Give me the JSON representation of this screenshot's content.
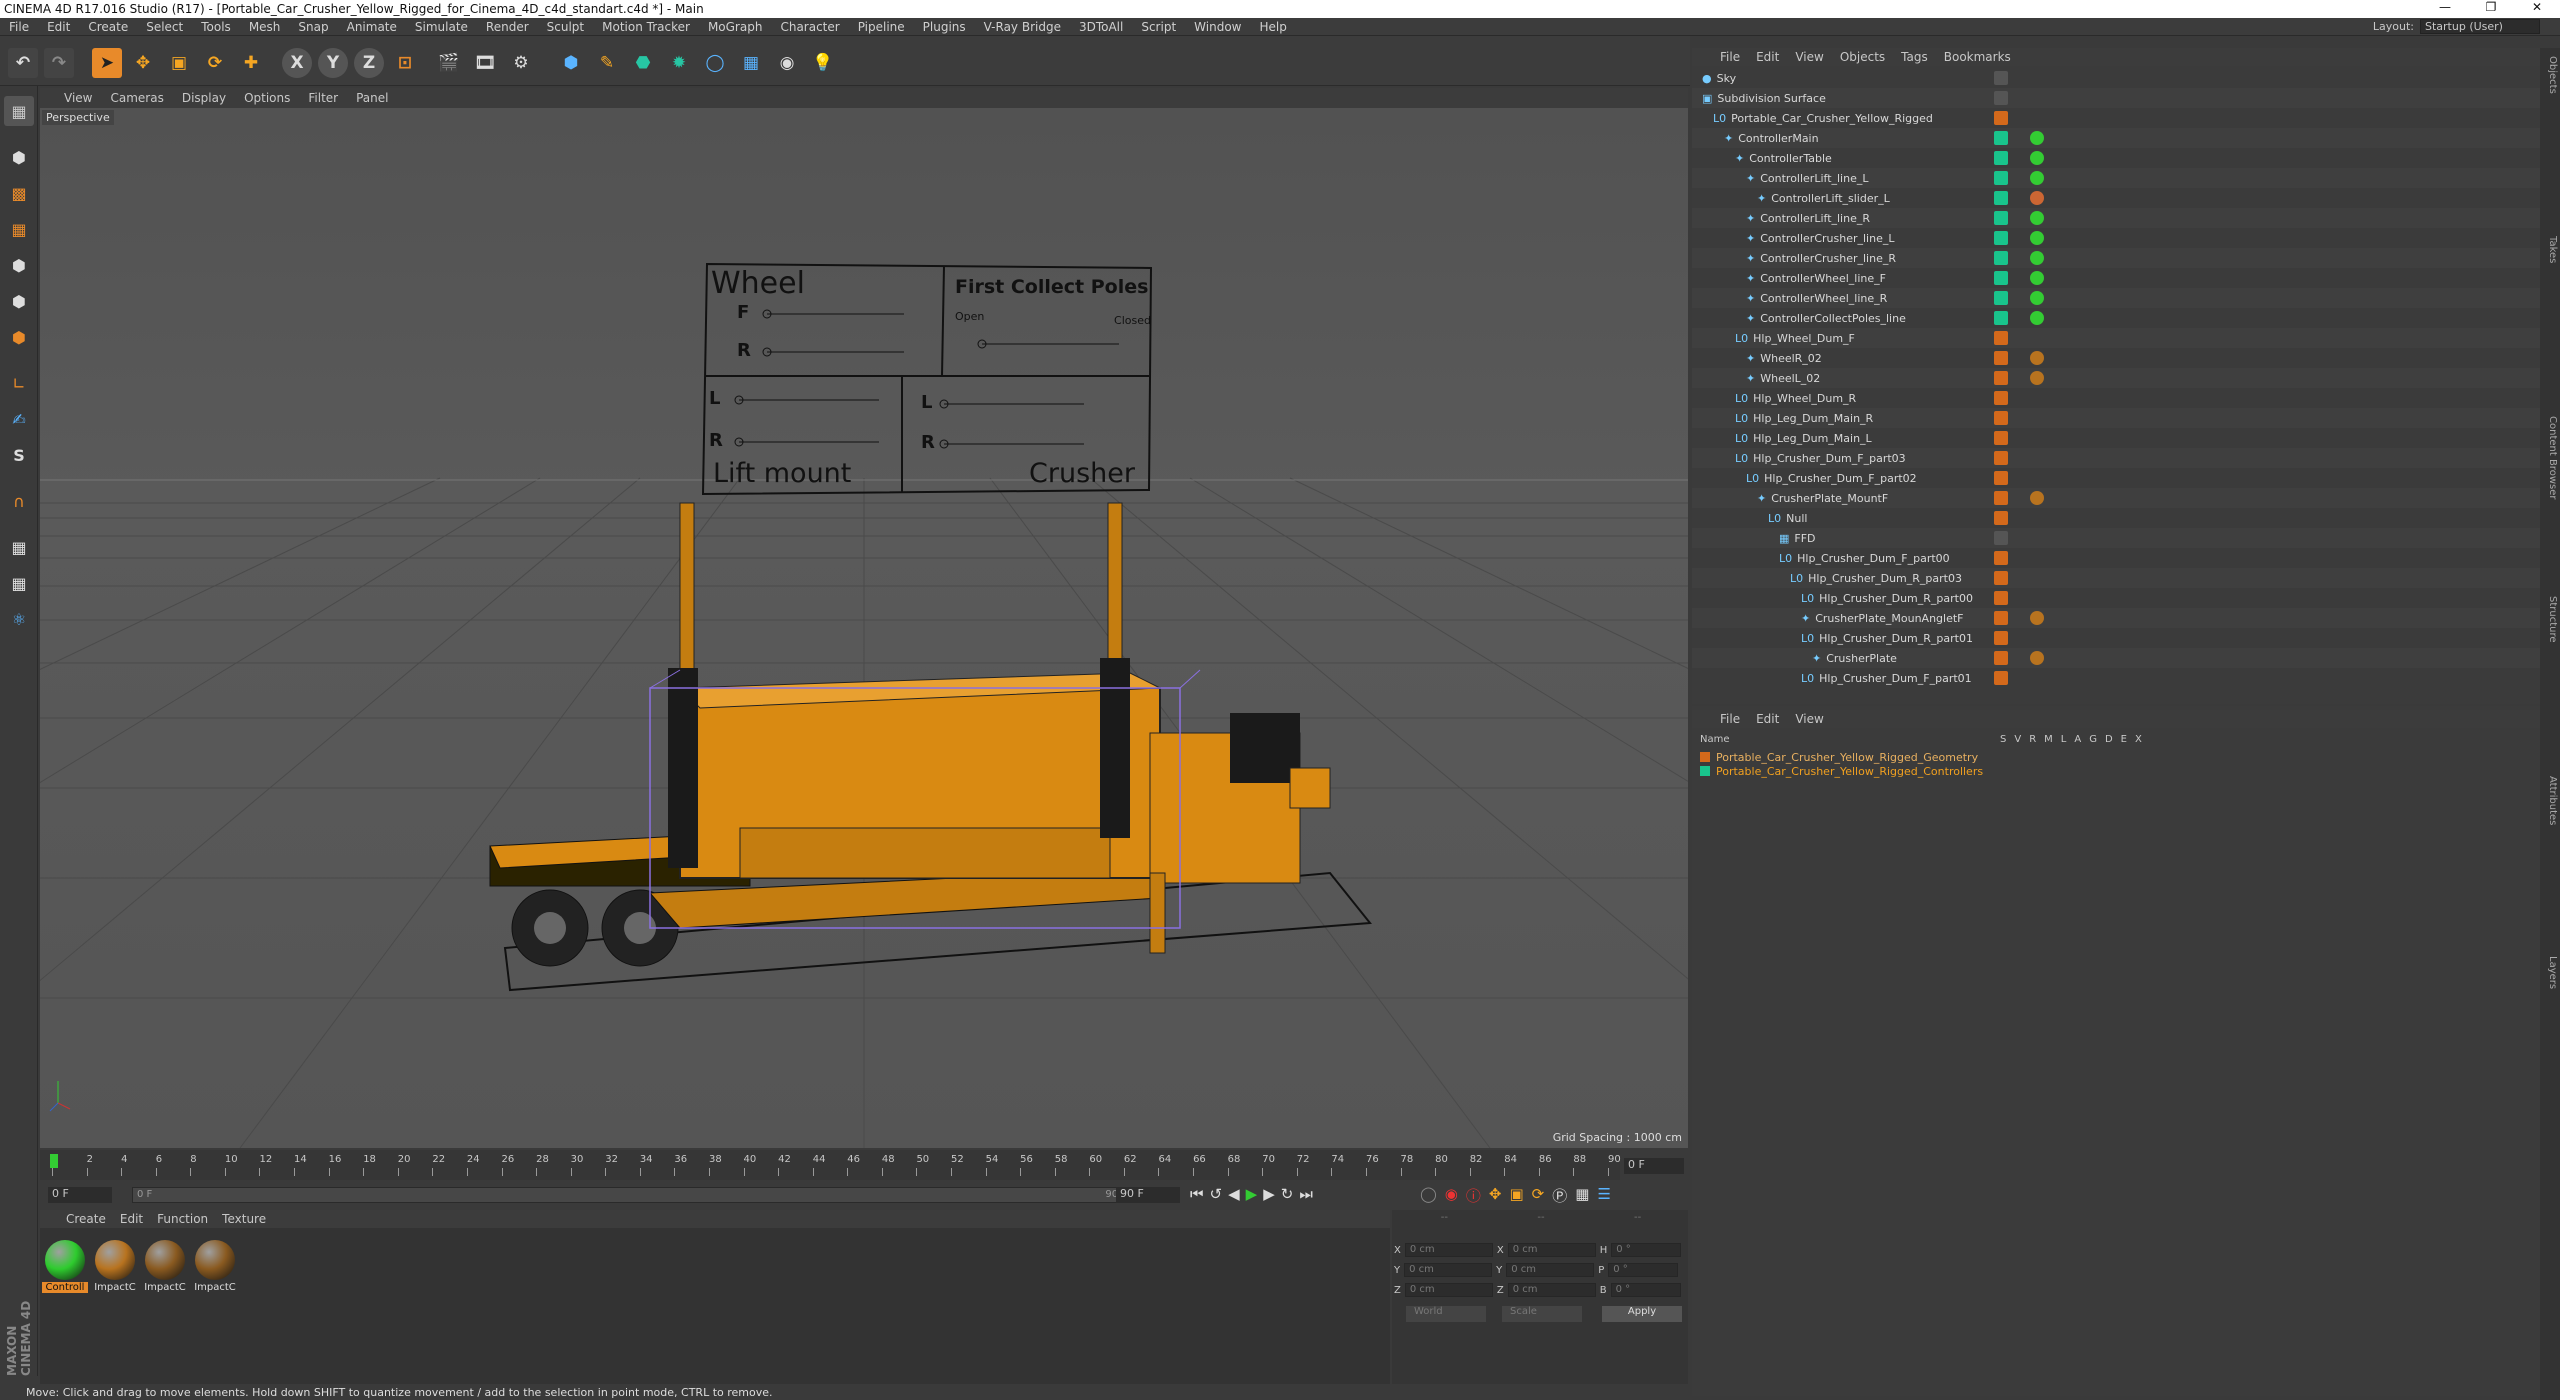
{
  "app": {
    "title": "CINEMA 4D R17.016 Studio (R17) - [Portable_Car_Crusher_Yellow_Rigged_for_Cinema_4D_c4d_standart.c4d *] - Main"
  },
  "menu": [
    "File",
    "Edit",
    "Create",
    "Select",
    "Tools",
    "Mesh",
    "Snap",
    "Animate",
    "Simulate",
    "Render",
    "Sculpt",
    "Motion Tracker",
    "MoGraph",
    "Character",
    "Pipeline",
    "Plugins",
    "V-Ray Bridge",
    "3DToAll",
    "Script",
    "Window",
    "Help"
  ],
  "layout": {
    "label": "Layout:",
    "value": "Startup (User)"
  },
  "toolbar": {
    "x": "X",
    "y": "Y",
    "z": "Z"
  },
  "viewport": {
    "menu": [
      "View",
      "Cameras",
      "Display",
      "Options",
      "Filter",
      "Panel"
    ],
    "label": "Perspective",
    "grid": "Grid Spacing : 1000 cm"
  },
  "panel_sign": {
    "wheel": "Wheel",
    "f": "F",
    "r": "R",
    "first": "First Collect Poles",
    "open": "Open",
    "closed": "Closed",
    "l1": "L",
    "r1": "R",
    "l2": "L",
    "r2": "R",
    "lift": "Lift mount",
    "crusher": "Crusher"
  },
  "timeline": {
    "ticks": [
      "0",
      "2",
      "4",
      "6",
      "8",
      "10",
      "12",
      "14",
      "16",
      "18",
      "20",
      "22",
      "24",
      "26",
      "28",
      "30",
      "32",
      "34",
      "36",
      "38",
      "40",
      "42",
      "44",
      "46",
      "48",
      "50",
      "52",
      "54",
      "56",
      "58",
      "60",
      "62",
      "64",
      "66",
      "68",
      "70",
      "72",
      "74",
      "76",
      "78",
      "80",
      "82",
      "84",
      "86",
      "88",
      "90"
    ],
    "frame": "0 F",
    "start": "0 F",
    "mid": "0 F",
    "end_inner": "90 F",
    "end": "90 F"
  },
  "materials": {
    "menu": [
      "Create",
      "Edit",
      "Function",
      "Texture"
    ],
    "items": [
      {
        "label": "Controll",
        "color": "#2ecc2e"
      },
      {
        "label": "ImpactC",
        "color": "#b8731f"
      },
      {
        "label": "ImpactC",
        "color": "#8a5a20"
      },
      {
        "label": "ImpactC",
        "color": "#8a5a20"
      }
    ]
  },
  "coords": {
    "x": "X",
    "y": "Y",
    "z": "Z",
    "h": "H",
    "p": "P",
    "b": "B",
    "v1": "0 cm",
    "v2": "0 cm",
    "v3": "0 °",
    "world": "World",
    "scale": "Scale",
    "apply": "Apply",
    "dash1": "--",
    "dash2": "--",
    "dash3": "--"
  },
  "status": "Move: Click and drag to move elements. Hold down SHIFT to quantize movement / add to the selection in point mode, CTRL to remove.",
  "objects": {
    "menu": [
      "File",
      "Edit",
      "View",
      "Objects",
      "Tags",
      "Bookmarks"
    ],
    "rows": [
      {
        "name": "Sky",
        "indent": 0,
        "tag": "#555",
        "icon": "●"
      },
      {
        "name": "Subdivision Surface",
        "indent": 0,
        "tag": "#555",
        "icon": "▣"
      },
      {
        "name": "Portable_Car_Crusher_Yellow_Rigged",
        "indent": 1,
        "tag": "#d4691b",
        "icon": "L0"
      },
      {
        "name": "ControllerMain",
        "indent": 2,
        "tag": "#19c48c",
        "icon": "✦",
        "g": "#3c3"
      },
      {
        "name": "ControllerTable",
        "indent": 3,
        "tag": "#19c48c",
        "icon": "✦",
        "g": "#3c3"
      },
      {
        "name": "ControllerLift_line_L",
        "indent": 4,
        "tag": "#19c48c",
        "icon": "✦",
        "g": "#3c3"
      },
      {
        "name": "ControllerLift_slider_L",
        "indent": 5,
        "tag": "#19c48c",
        "icon": "✦",
        "g": "#c63"
      },
      {
        "name": "ControllerLift_line_R",
        "indent": 4,
        "tag": "#19c48c",
        "icon": "✦",
        "g": "#3c3"
      },
      {
        "name": "ControllerCrusher_line_L",
        "indent": 4,
        "tag": "#19c48c",
        "icon": "✦",
        "g": "#3c3"
      },
      {
        "name": "ControllerCrusher_line_R",
        "indent": 4,
        "tag": "#19c48c",
        "icon": "✦",
        "g": "#3c3"
      },
      {
        "name": "ControllerWheel_line_F",
        "indent": 4,
        "tag": "#19c48c",
        "icon": "✦",
        "g": "#3c3"
      },
      {
        "name": "ControllerWheel_line_R",
        "indent": 4,
        "tag": "#19c48c",
        "icon": "✦",
        "g": "#3c3"
      },
      {
        "name": "ControllerCollectPoles_line",
        "indent": 4,
        "tag": "#19c48c",
        "icon": "✦",
        "g": "#3c3"
      },
      {
        "name": "Hlp_Wheel_Dum_F",
        "indent": 3,
        "tag": "#d4691b",
        "icon": "L0"
      },
      {
        "name": "WheelR_02",
        "indent": 4,
        "tag": "#d4691b",
        "icon": "✦",
        "g": "#b8731f"
      },
      {
        "name": "WheelL_02",
        "indent": 4,
        "tag": "#d4691b",
        "icon": "✦",
        "g": "#b8731f"
      },
      {
        "name": "Hlp_Wheel_Dum_R",
        "indent": 3,
        "tag": "#d4691b",
        "icon": "L0"
      },
      {
        "name": "Hlp_Leg_Dum_Main_R",
        "indent": 3,
        "tag": "#d4691b",
        "icon": "L0"
      },
      {
        "name": "Hlp_Leg_Dum_Main_L",
        "indent": 3,
        "tag": "#d4691b",
        "icon": "L0"
      },
      {
        "name": "Hlp_Crusher_Dum_F_part03",
        "indent": 3,
        "tag": "#d4691b",
        "icon": "L0"
      },
      {
        "name": "Hlp_Crusher_Dum_F_part02",
        "indent": 4,
        "tag": "#d4691b",
        "icon": "L0"
      },
      {
        "name": "CrusherPlate_MountF",
        "indent": 5,
        "tag": "#d4691b",
        "icon": "✦",
        "g": "#b8731f"
      },
      {
        "name": "Null",
        "indent": 6,
        "tag": "#d4691b",
        "icon": "L0"
      },
      {
        "name": "FFD",
        "indent": 7,
        "tag": "#555",
        "icon": "▦"
      },
      {
        "name": "Hlp_Crusher_Dum_F_part00",
        "indent": 7,
        "tag": "#d4691b",
        "icon": "L0"
      },
      {
        "name": "Hlp_Crusher_Dum_R_part03",
        "indent": 8,
        "tag": "#d4691b",
        "icon": "L0"
      },
      {
        "name": "Hlp_Crusher_Dum_R_part00",
        "indent": 9,
        "tag": "#d4691b",
        "icon": "L0"
      },
      {
        "name": "CrusherPlate_MounAngletF",
        "indent": 9,
        "tag": "#d4691b",
        "icon": "✦",
        "g": "#b8731f"
      },
      {
        "name": "Hlp_Crusher_Dum_R_part01",
        "indent": 9,
        "tag": "#d4691b",
        "icon": "L0"
      },
      {
        "name": "CrusherPlate",
        "indent": 10,
        "tag": "#d4691b",
        "icon": "✦",
        "g": "#b8731f"
      },
      {
        "name": "Hlp_Crusher_Dum_F_part01",
        "indent": 9,
        "tag": "#d4691b",
        "icon": "L0"
      }
    ]
  },
  "layers": {
    "menu": [
      "File",
      "Edit",
      "View"
    ],
    "header": {
      "name": "Name",
      "cols": [
        "S",
        "V",
        "R",
        "M",
        "L",
        "A",
        "G",
        "D",
        "E",
        "X"
      ]
    },
    "rows": [
      {
        "name": "Portable_Car_Crusher_Yellow_Rigged_Geometry",
        "color": "#d4691b",
        "text": "#e8b060"
      },
      {
        "name": "Portable_Car_Crusher_Yellow_Rigged_Controllers",
        "color": "#19c48c",
        "text": "#f0a020"
      }
    ]
  },
  "right_tabs": [
    "Objects",
    "Takes",
    "Content Browser",
    "Structure",
    "Attributes",
    "Layers"
  ]
}
